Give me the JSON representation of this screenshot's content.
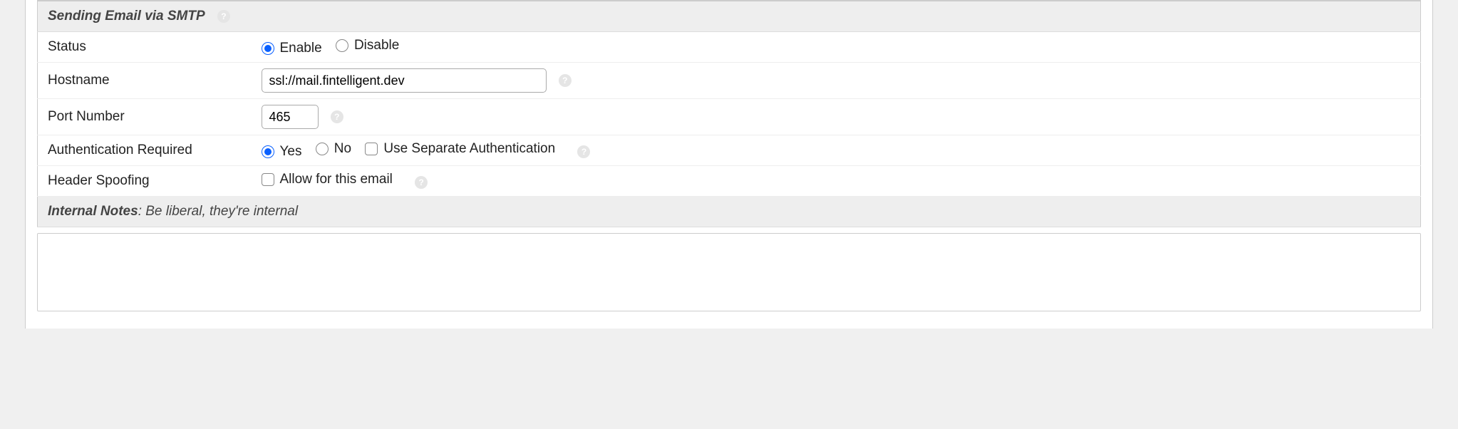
{
  "sections": {
    "smtp": {
      "title": "Sending Email via SMTP",
      "fields": {
        "status": {
          "label": "Status",
          "options": {
            "enable": "Enable",
            "disable": "Disable"
          },
          "value": "enable"
        },
        "hostname": {
          "label": "Hostname",
          "value": "ssl://mail.fintelligent.dev"
        },
        "port": {
          "label": "Port Number",
          "value": "465"
        },
        "auth": {
          "label": "Authentication Required",
          "options": {
            "yes": "Yes",
            "no": "No"
          },
          "value": "yes",
          "separate_label": "Use Separate Authentication"
        },
        "spoofing": {
          "label": "Header Spoofing",
          "allow_label": "Allow for this email"
        }
      }
    },
    "notes": {
      "title": "Internal Notes",
      "hint": ": Be liberal, they're internal"
    }
  },
  "icons": {
    "help": "?"
  }
}
